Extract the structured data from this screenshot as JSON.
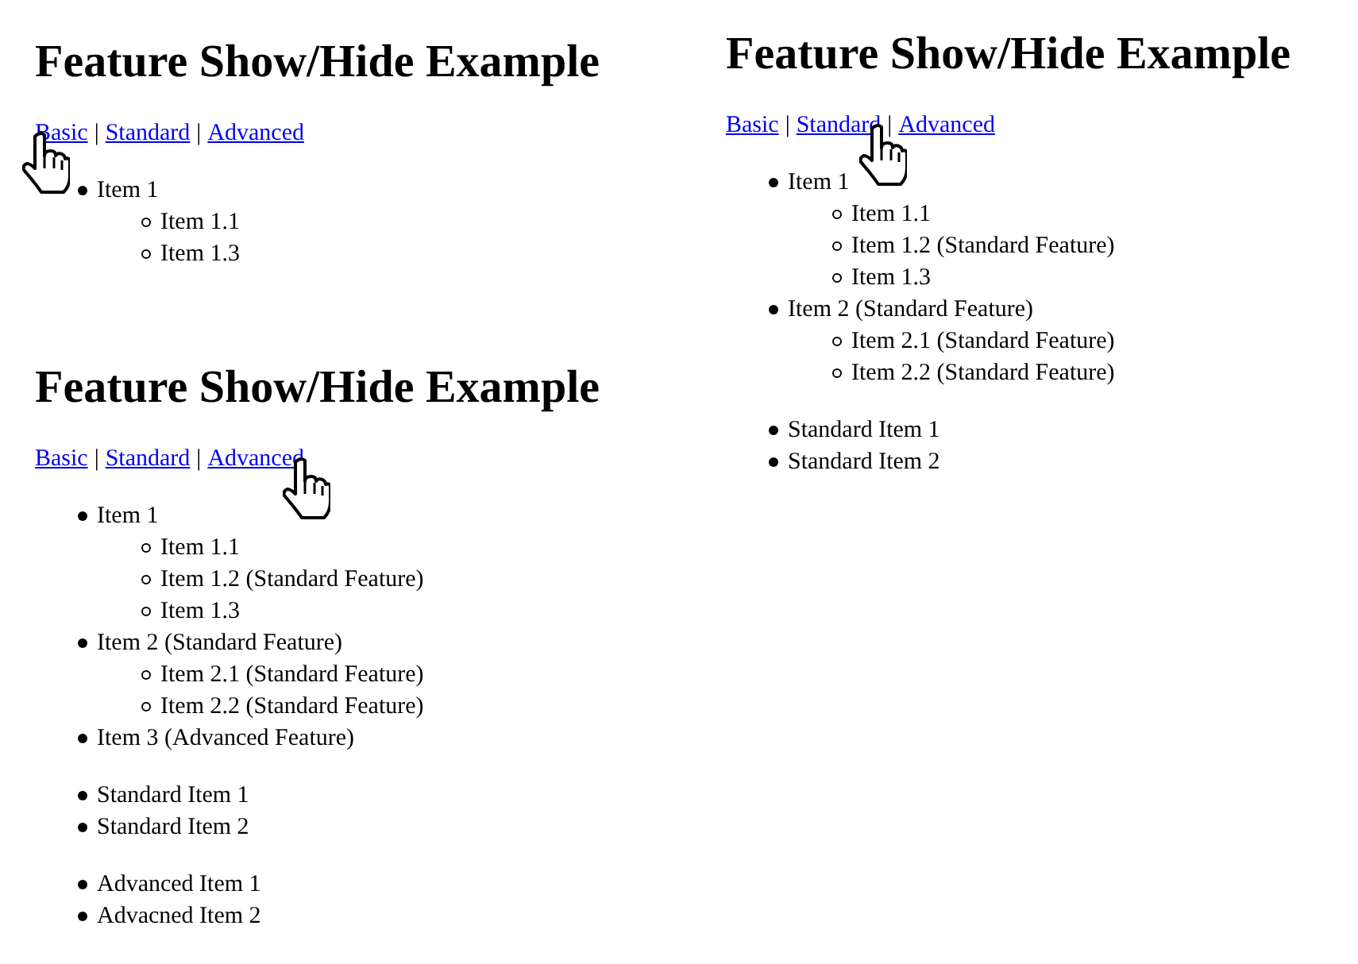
{
  "panels": [
    {
      "heading": "Feature Show/Hide Example",
      "nav": [
        {
          "kind": "link",
          "label": "Basic",
          "hovered": true
        },
        {
          "kind": "separator",
          "text": "|"
        },
        {
          "kind": "link",
          "label": "Standard",
          "hovered": false
        },
        {
          "kind": "separator",
          "text": "|"
        },
        {
          "kind": "link",
          "label": "Advanced",
          "hovered": false
        }
      ],
      "lists": [
        [
          {
            "label": "Item 1",
            "children": [
              {
                "label": "Item 1.1"
              },
              {
                "label": "Item 1.3"
              }
            ]
          }
        ]
      ]
    },
    {
      "heading": "Feature Show/Hide Example",
      "nav": [
        {
          "kind": "link",
          "label": "Basic",
          "hovered": false
        },
        {
          "kind": "separator",
          "text": "|"
        },
        {
          "kind": "link",
          "label": "Standard",
          "hovered": true
        },
        {
          "kind": "separator",
          "text": "|"
        },
        {
          "kind": "link",
          "label": "Advanced",
          "hovered": false
        }
      ],
      "lists": [
        [
          {
            "label": "Item 1",
            "children": [
              {
                "label": "Item 1.1"
              },
              {
                "label": "Item 1.2 (Standard Feature)"
              },
              {
                "label": "Item 1.3"
              }
            ]
          },
          {
            "label": "Item 2 (Standard Feature)",
            "children": [
              {
                "label": "Item 2.1 (Standard Feature)"
              },
              {
                "label": "Item 2.2 (Standard Feature)"
              }
            ]
          }
        ],
        [
          {
            "label": "Standard Item 1"
          },
          {
            "label": "Standard Item 2"
          }
        ]
      ]
    },
    {
      "heading": "Feature Show/Hide Example",
      "nav": [
        {
          "kind": "link",
          "label": "Basic",
          "hovered": false
        },
        {
          "kind": "separator",
          "text": "|"
        },
        {
          "kind": "link",
          "label": "Standard",
          "hovered": false
        },
        {
          "kind": "separator",
          "text": "|"
        },
        {
          "kind": "link",
          "label": "Advanced",
          "hovered": true
        }
      ],
      "lists": [
        [
          {
            "label": "Item 1",
            "children": [
              {
                "label": "Item 1.1"
              },
              {
                "label": "Item 1.2 (Standard Feature)"
              },
              {
                "label": "Item 1.3"
              }
            ]
          },
          {
            "label": "Item 2 (Standard Feature)",
            "children": [
              {
                "label": "Item 2.1 (Standard Feature)"
              },
              {
                "label": "Item 2.2 (Standard Feature)"
              }
            ]
          },
          {
            "label": "Item 3 (Advanced Feature)"
          }
        ],
        [
          {
            "label": "Standard Item 1"
          },
          {
            "label": "Standard Item 2"
          }
        ],
        [
          {
            "label": "Advanced Item 1"
          },
          {
            "label": "Advacned Item 2"
          }
        ]
      ]
    }
  ]
}
